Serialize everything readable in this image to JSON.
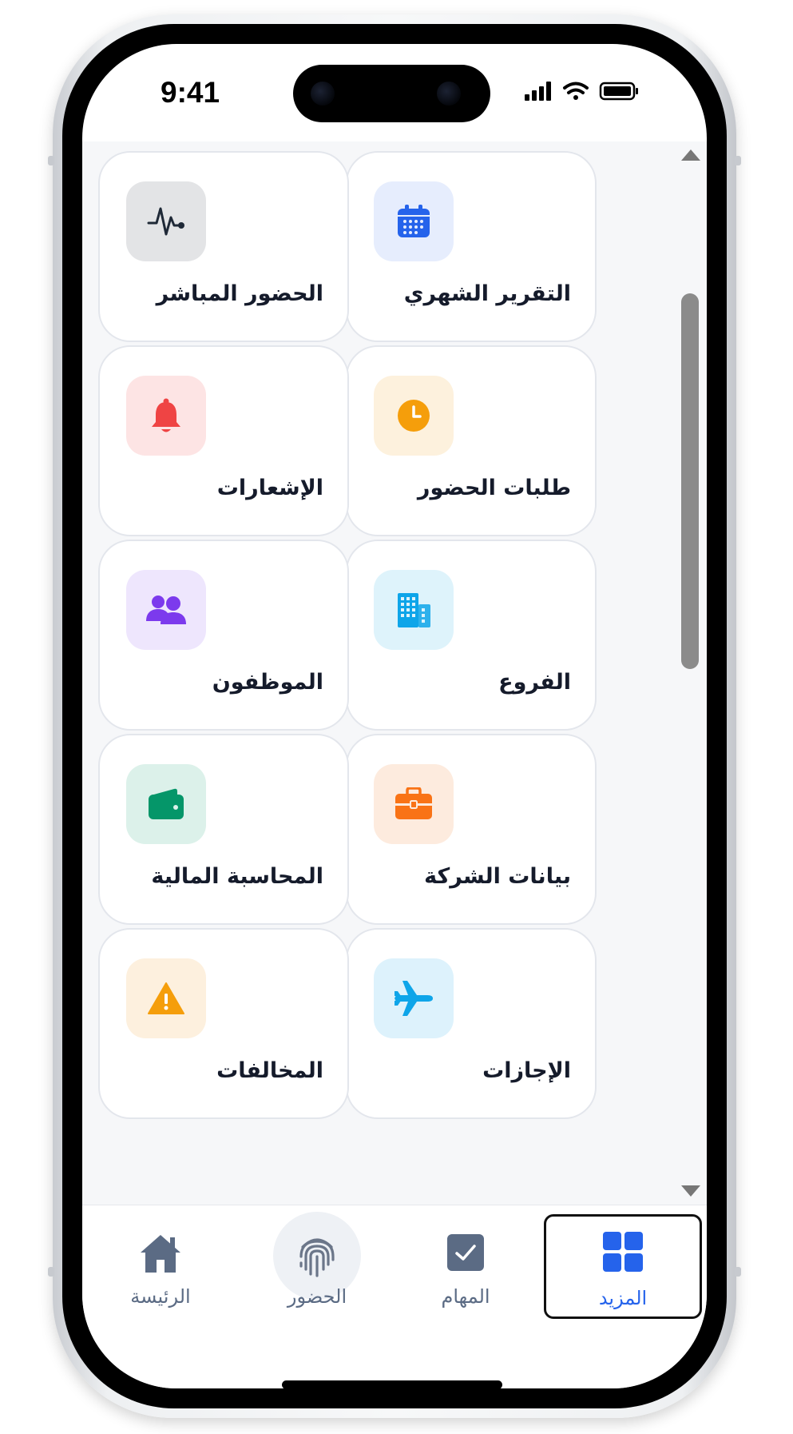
{
  "status_bar": {
    "time": "9:41"
  },
  "menu_cards": [
    {
      "label": "التقرير الشهري",
      "icon": "calendar-icon",
      "tile_color": "#e6edfd",
      "icon_color": "#2563eb"
    },
    {
      "label": "الحضور المباشر",
      "icon": "activity-pulse-icon",
      "tile_color": "#e3e4e6",
      "icon_color": "#1f2937"
    },
    {
      "label": "طلبات الحضور",
      "icon": "clock-icon",
      "tile_color": "#fdf1dd",
      "icon_color": "#f59e0b"
    },
    {
      "label": "الإشعارات",
      "icon": "bell-icon",
      "tile_color": "#fde4e4",
      "icon_color": "#ef4444"
    },
    {
      "label": "الفروع",
      "icon": "building-icon",
      "tile_color": "#def3fb",
      "icon_color": "#0ea5e9"
    },
    {
      "label": "الموظفون",
      "icon": "users-icon",
      "tile_color": "#eee6fd",
      "icon_color": "#7c3aed"
    },
    {
      "label": "بيانات الشركة",
      "icon": "briefcase-icon",
      "tile_color": "#fdebde",
      "icon_color": "#f97316"
    },
    {
      "label": "المحاسبة المالية",
      "icon": "wallet-icon",
      "tile_color": "#dcf1ea",
      "icon_color": "#059669"
    },
    {
      "label": "الإجازات",
      "icon": "airplane-icon",
      "tile_color": "#ddf2fc",
      "icon_color": "#0ea5e9"
    },
    {
      "label": "المخالفات",
      "icon": "warning-icon",
      "tile_color": "#fdf0de",
      "icon_color": "#f59e0b"
    }
  ],
  "tab_bar": {
    "home": "الرئيسة",
    "attendance": "الحضور",
    "tasks": "المهام",
    "more": "المزيد",
    "active_tab": "more",
    "active_color": "#2563eb",
    "inactive_color": "#5b6b84"
  }
}
